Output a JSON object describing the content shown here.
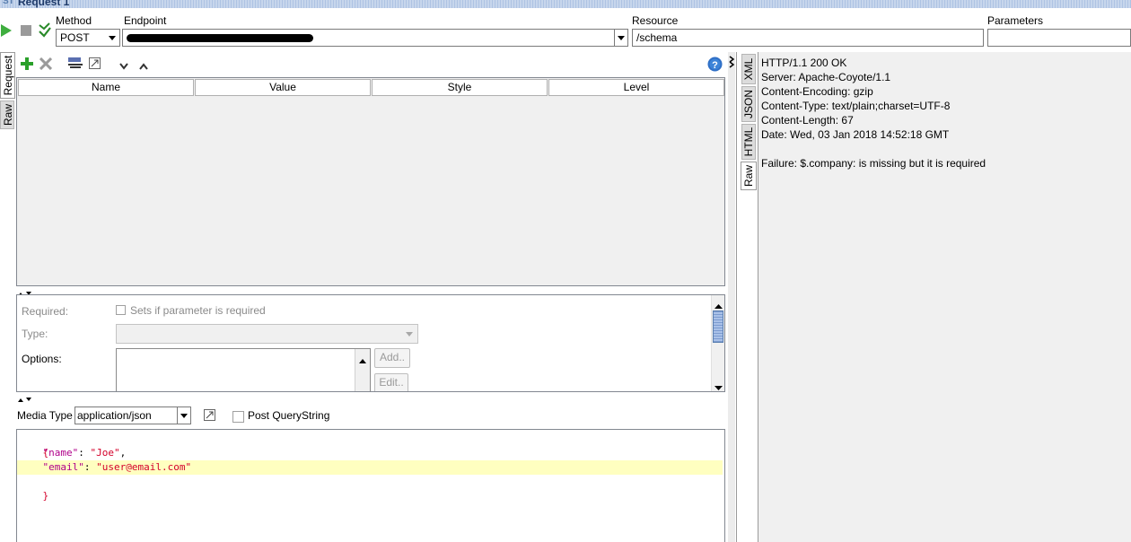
{
  "title": {
    "prefix": "ST",
    "tab": "Request 1"
  },
  "toolbar": {
    "method_label": "Method",
    "method_value": "POST",
    "endpoint_label": "Endpoint",
    "endpoint_value": "",
    "resource_label": "Resource",
    "resource_value": "/schema",
    "parameters_label": "Parameters",
    "parameters_value": ""
  },
  "left_tabs": [
    "Request",
    "Raw"
  ],
  "params_table": {
    "columns": [
      "Name",
      "Value",
      "Style",
      "Level"
    ]
  },
  "params_props": {
    "required_label": "Required:",
    "required_check_label": "Sets if parameter is required",
    "type_label": "Type:",
    "options_label": "Options:",
    "add_button": "Add..",
    "edit_button": "Edit.."
  },
  "media": {
    "label": "Media Type",
    "value": "application/json",
    "post_query_label": "Post QueryString"
  },
  "body_lines": [
    "{",
    "    \"name\": \"Joe\",",
    "    \"email\": \"user@email.com\"",
    "}"
  ],
  "body_tokens": {
    "open": "{",
    "name_key": "\"name\"",
    "name_val": "\"Joe\"",
    "email_key": "\"email\"",
    "email_val": "\"user@email.com\"",
    "close": "}",
    "colon": ": ",
    "comma": ","
  },
  "response_tabs": [
    "XML",
    "JSON",
    "HTML",
    "Raw"
  ],
  "response_lines": [
    "HTTP/1.1 200 OK",
    "Server: Apache-Coyote/1.1",
    "Content-Encoding: gzip",
    "Content-Type: text/plain;charset=UTF-8",
    "Content-Length: 67",
    "Date: Wed, 03 Jan 2018 14:52:18 GMT",
    "",
    "Failure: $.company: is missing but it is required"
  ],
  "colors": {
    "highlight_line": "#ffffc0",
    "accent_green": "#2aa02a",
    "help_blue": "#2f6fc6"
  }
}
